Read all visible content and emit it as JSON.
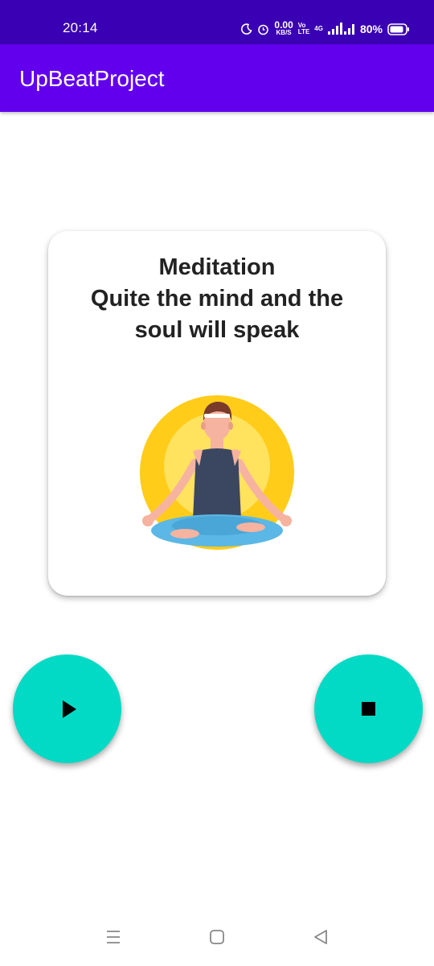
{
  "status_bar": {
    "time": "20:14",
    "speed_value": "0.00",
    "speed_unit": "KB/S",
    "volte_top": "Vo",
    "volte_bottom": "LTE",
    "network": "4G",
    "battery": "80%",
    "icons": [
      "moon-icon",
      "alarm-icon",
      "signal-icon",
      "battery-icon"
    ]
  },
  "app_bar": {
    "title": "UpBeatProject"
  },
  "card": {
    "lines": [
      "Meditation",
      "Quite the mind and the",
      "soul will speak"
    ],
    "image": "meditation-illustration"
  },
  "controls": {
    "play_icon": "play-icon",
    "stop_icon": "stop-icon",
    "fab_color": "#03dac5"
  },
  "nav_bar": {
    "icons": [
      "recents-icon",
      "home-icon",
      "back-icon"
    ]
  },
  "colors": {
    "status_bar": "#3a00b3",
    "app_bar": "#6200ee",
    "fab": "#03dac5"
  }
}
